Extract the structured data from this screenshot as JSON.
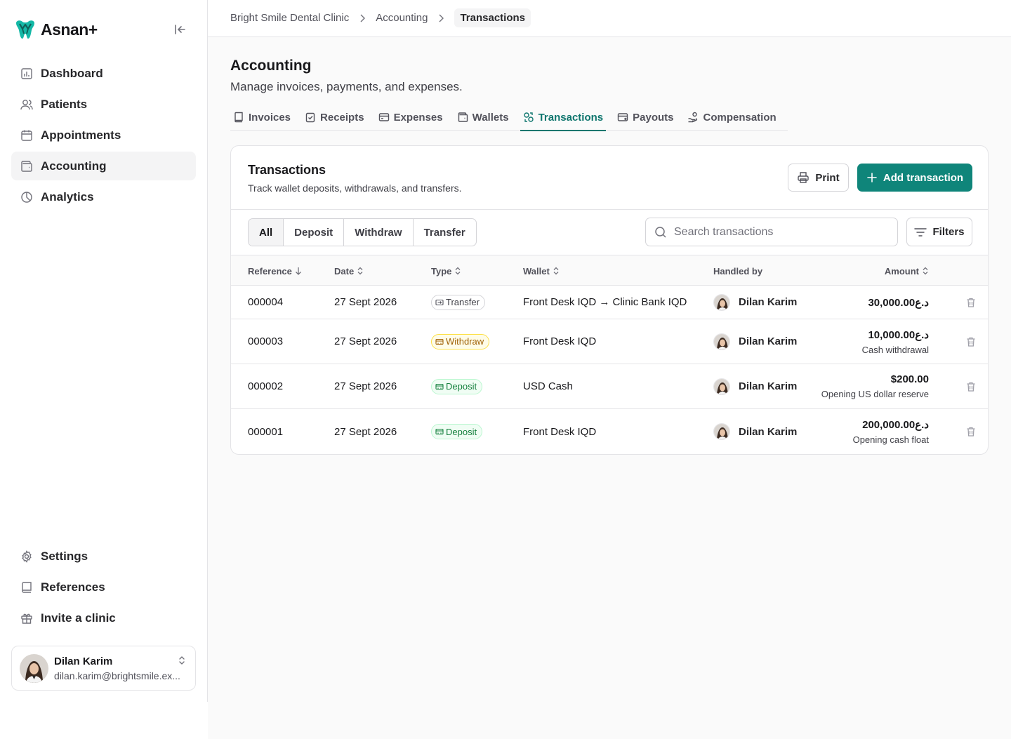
{
  "brand": {
    "name": "Asnan+"
  },
  "sidebar": {
    "items": [
      {
        "label": "Dashboard",
        "icon": "chart-icon"
      },
      {
        "label": "Patients",
        "icon": "users-icon"
      },
      {
        "label": "Appointments",
        "icon": "calendar-icon"
      },
      {
        "label": "Accounting",
        "icon": "wallet-icon",
        "active": true
      },
      {
        "label": "Analytics",
        "icon": "pie-chart-icon"
      }
    ],
    "bottom_items": [
      {
        "label": "Settings",
        "icon": "gear-icon"
      },
      {
        "label": "References",
        "icon": "book-icon"
      },
      {
        "label": "Invite a clinic",
        "icon": "gift-icon"
      }
    ],
    "user": {
      "name": "Dilan Karim",
      "email": "dilan.karim@brightsmile.ex..."
    }
  },
  "breadcrumb": {
    "items": [
      "Bright Smile Dental Clinic",
      "Accounting"
    ],
    "current": "Transactions"
  },
  "header": {
    "title": "Accounting",
    "subtitle": "Manage invoices, payments, and expenses."
  },
  "tabs": [
    {
      "label": "Invoices",
      "icon": "book-icon"
    },
    {
      "label": "Receipts",
      "icon": "clipboard-check-icon"
    },
    {
      "label": "Expenses",
      "icon": "card-icon"
    },
    {
      "label": "Wallets",
      "icon": "wallet-icon"
    },
    {
      "label": "Transactions",
      "icon": "transactions-icon",
      "active": true
    },
    {
      "label": "Payouts",
      "icon": "payout-icon"
    },
    {
      "label": "Compensation",
      "icon": "hand-coins-icon"
    }
  ],
  "card": {
    "title": "Transactions",
    "subtitle": "Track wallet deposits, withdrawals, and transfers.",
    "print_label": "Print",
    "add_label": "Add transaction"
  },
  "filters": {
    "segments": [
      "All",
      "Deposit",
      "Withdraw",
      "Transfer"
    ],
    "active_segment": "All",
    "search_placeholder": "Search transactions",
    "filters_label": "Filters"
  },
  "table": {
    "columns": [
      "Reference",
      "Date",
      "Type",
      "Wallet",
      "Handled by",
      "Amount"
    ],
    "rows": [
      {
        "reference": "000004",
        "date": "27 Sept 2026",
        "type": "Transfer",
        "wallet": "Front Desk IQD → Clinic Bank IQD",
        "handler": "Dilan Karim",
        "amount": "30,000.00د.ع",
        "note": ""
      },
      {
        "reference": "000003",
        "date": "27 Sept 2026",
        "type": "Withdraw",
        "wallet": "Front Desk IQD",
        "handler": "Dilan Karim",
        "amount": "10,000.00د.ع",
        "note": "Cash withdrawal"
      },
      {
        "reference": "000002",
        "date": "27 Sept 2026",
        "type": "Deposit",
        "wallet": "USD Cash",
        "handler": "Dilan Karim",
        "amount": "$200.00",
        "note": "Opening US dollar reserve"
      },
      {
        "reference": "000001",
        "date": "27 Sept 2026",
        "type": "Deposit",
        "wallet": "Front Desk IQD",
        "handler": "Dilan Karim",
        "amount": "200,000.00د.ع",
        "note": "Opening cash float"
      }
    ]
  },
  "colors": {
    "accent": "#0f857a",
    "accent_text": "#0f766e"
  }
}
